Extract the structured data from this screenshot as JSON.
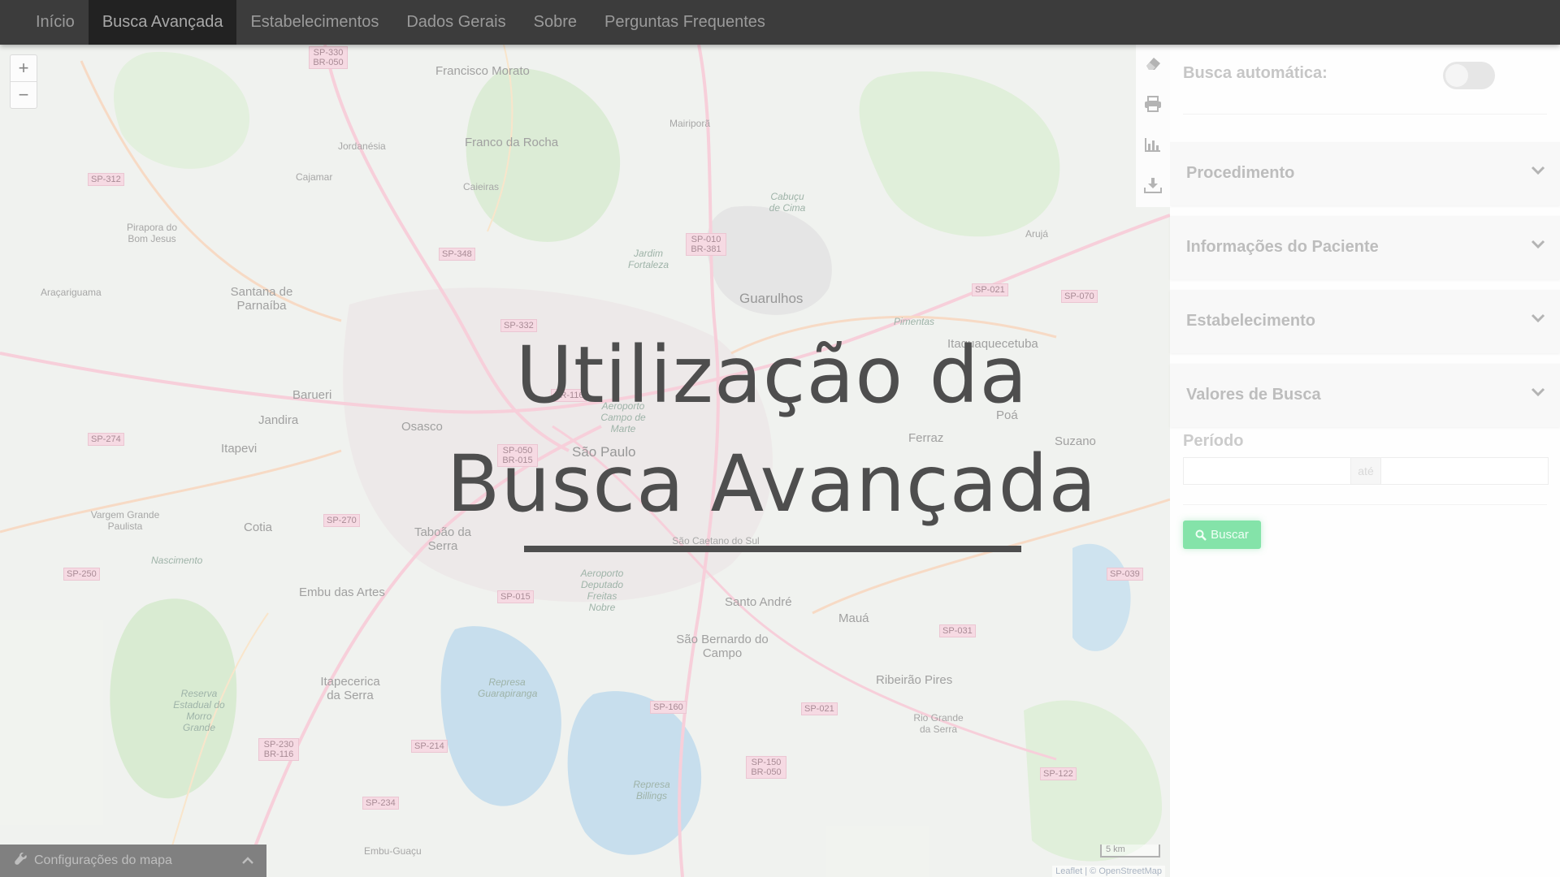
{
  "nav": {
    "items": [
      {
        "label": "Início"
      },
      {
        "label": "Busca Avançada"
      },
      {
        "label": "Estabelecimentos"
      },
      {
        "label": "Dados Gerais"
      },
      {
        "label": "Sobre"
      },
      {
        "label": "Perguntas Frequentes"
      }
    ],
    "active_index": 1
  },
  "map": {
    "zoom_in": "+",
    "zoom_out": "−",
    "places": [
      "Francisco Morato",
      "Franco da Rocha",
      "Mairiporã",
      "Jordanésia",
      "Cajamar",
      "Caieiras",
      "Pirapora do Bom Jesus",
      "Santana de Parnaíba",
      "Araçariguama",
      "Guarulhos",
      "Arujá",
      "Itaquaquecetuba",
      "Barueri",
      "Jandira",
      "Osasco",
      "Itapevi",
      "São Paulo",
      "Poá",
      "Suzano",
      "Ferraz",
      "Vargem Grande Paulista",
      "Cotia",
      "Taboão da Serra",
      "São Caetano do Sul",
      "Embu das Artes",
      "Santo André",
      "Mauá",
      "São Bernardo do Campo",
      "Itapecerica da Serra",
      "Ribeirão Pires",
      "Rio Grande da Serra",
      "Embu-Guaçu",
      "Jardim Fortaleza",
      "Cabuçu de Cima",
      "Pimentas",
      "Reserva Estadual do Morro Grande",
      "Nascimento",
      "Aeroporto Deputado Freitas Nobre",
      "Aeroporto Campo de Marte",
      "Represa Guarapiranga",
      "Represa Billings"
    ],
    "road_shields": [
      "SP-330 BR-050",
      "SP-312",
      "SP-348",
      "SP-332",
      "SP-010 BR-381",
      "SP-021",
      "SP-070",
      "SP-274",
      "SP-050 BR-015",
      "SP-270",
      "SP-250",
      "SP-015",
      "SP-039",
      "SP-031",
      "SP-160",
      "SP-021",
      "SP-230 BR-116",
      "SP-214",
      "SP-150 BR-050",
      "SP-122",
      "SP-234",
      "BR-116"
    ],
    "scale_label": "5 km",
    "attribution": "Leaflet | © OpenStreetMap",
    "settings_label": "Configurações do mapa"
  },
  "toolbar": {
    "icons": [
      "eraser-icon",
      "print-icon",
      "bar-chart-icon",
      "download-icon"
    ]
  },
  "sidebar": {
    "auto_search_label": "Busca automática:",
    "auto_search_on": false,
    "accordions": [
      {
        "title": "Procedimento"
      },
      {
        "title": "Informações do Paciente"
      },
      {
        "title": "Estabelecimento"
      },
      {
        "title": "Valores de Busca"
      }
    ],
    "period_label": "Período",
    "period_from": "",
    "period_sep": "até",
    "period_to": "",
    "search_button": "Buscar",
    "accent_color": "#43d47c"
  },
  "overlay": {
    "title_line1": "Utilização da",
    "title_line2": "Busca Avançada"
  }
}
